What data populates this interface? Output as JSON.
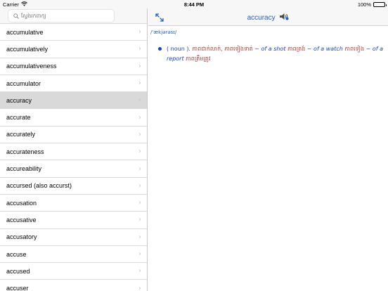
{
  "status_bar": {
    "carrier": "Carrier",
    "time": "8:44 PM",
    "battery": "100%",
    "battery_level": 1.0
  },
  "search": {
    "placeholder": "ស្វែងរកពាក្យ",
    "icon": "search-icon"
  },
  "word_list": [
    "accumulative",
    "accumulatively",
    "accumulativeness",
    "accumulator",
    "accuracy",
    "accurate",
    "accurately",
    "accurateness",
    "accureability",
    "accursed (also accurst)",
    "accusation",
    "accusative",
    "accusatory",
    "accuse",
    "accused",
    "accuser"
  ],
  "selected_word": "accuracy",
  "detail": {
    "title": "accuracy",
    "phonetic": "/'ækjərəsɪ/",
    "definition": {
      "pos": "( noun ).",
      "part1": " ភាពជាក់លាក់, ភាពទៀងទាត់ ",
      "ex1": "~ of a shot",
      "part2": " ភាពត្រង់ ",
      "ex2": "~ of a watch",
      "part3": " ភាពទៀង ",
      "ex3": "~ of a report",
      "part4": " ភាពត្រឹមត្រូវ"
    }
  },
  "colors": {
    "accent": "#1b5fd6",
    "definition_text": "#b23b3b",
    "selected_row": "#d9d9d9"
  }
}
